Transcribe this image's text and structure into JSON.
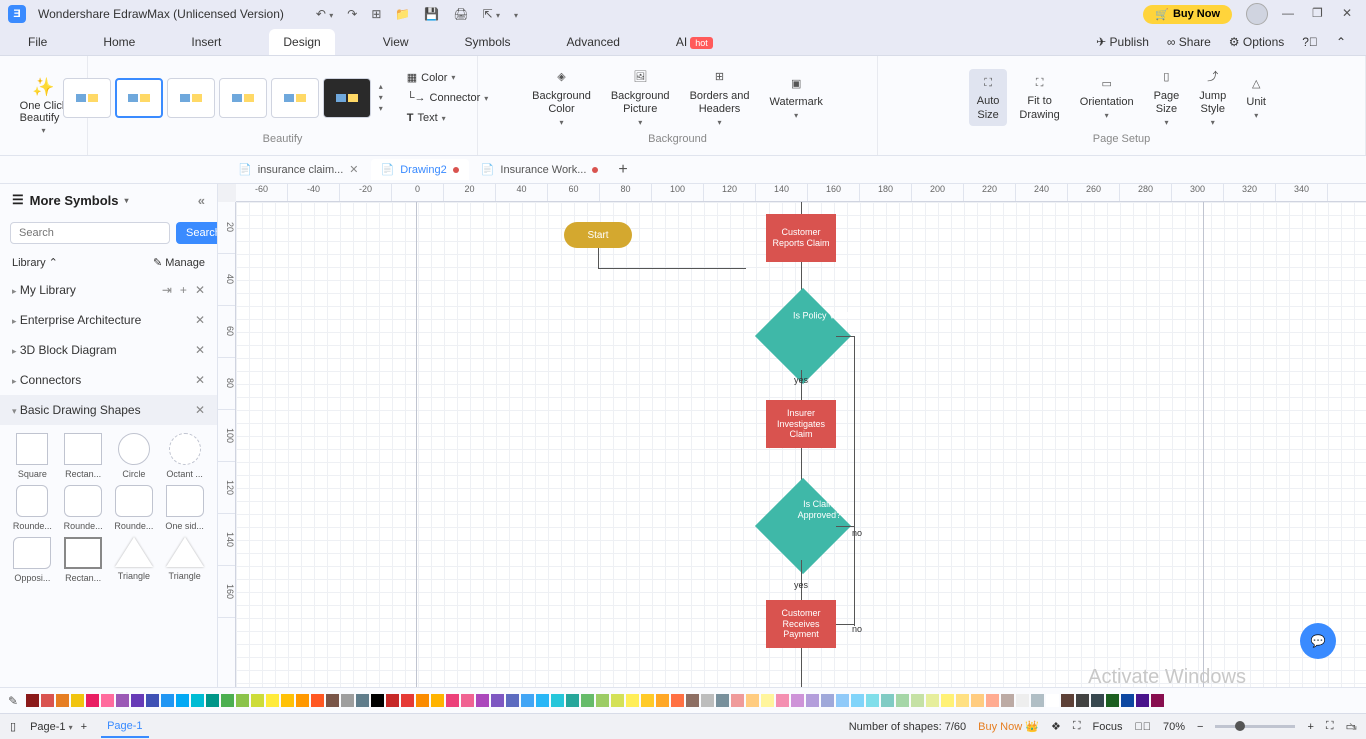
{
  "titlebar": {
    "app_name": "Wondershare EdrawMax (Unlicensed Version)",
    "buy": "Buy Now"
  },
  "menu": {
    "items": [
      "File",
      "Home",
      "Insert",
      "Design",
      "View",
      "Symbols",
      "Advanced",
      "AI"
    ],
    "active": 3,
    "ai_badge": "hot",
    "publish": "Publish",
    "share": "Share",
    "options": "Options"
  },
  "ribbon": {
    "beautify_btn": "One Click\nBeautify",
    "beautify_label": "Beautify",
    "color": "Color",
    "connector": "Connector",
    "text": "Text",
    "bg_color": "Background\nColor",
    "bg_pic": "Background\nPicture",
    "borders": "Borders and\nHeaders",
    "watermark": "Watermark",
    "bg_label": "Background",
    "auto_size": "Auto\nSize",
    "fit": "Fit to\nDrawing",
    "orient": "Orientation",
    "page_size": "Page\nSize",
    "jump": "Jump\nStyle",
    "unit": "Unit",
    "ps_label": "Page Setup"
  },
  "tabs": [
    {
      "name": "insurance claim...",
      "active": false,
      "dirty": false,
      "closable": true
    },
    {
      "name": "Drawing2",
      "active": true,
      "dirty": true,
      "closable": false
    },
    {
      "name": "Insurance Work...",
      "active": false,
      "dirty": true,
      "closable": false
    }
  ],
  "sidebar": {
    "title": "More Symbols",
    "search_ph": "Search",
    "search_btn": "Search",
    "library": "Library",
    "manage": "Manage",
    "cats": [
      "My Library",
      "Enterprise Architecture",
      "3D Block Diagram",
      "Connectors",
      "Basic Drawing Shapes"
    ],
    "shapes": [
      "Square",
      "Rectan...",
      "Circle",
      "Octant ...",
      "Rounde...",
      "Rounde...",
      "Rounde...",
      "One sid...",
      "Opposi...",
      "Rectan...",
      "Triangle",
      "Triangle"
    ]
  },
  "ruler_h": [
    "-60",
    "-40",
    "-20",
    "0",
    "20",
    "40",
    "60",
    "80",
    "100",
    "120",
    "140",
    "160",
    "180",
    "200",
    "220",
    "240",
    "260",
    "280",
    "300",
    "320",
    "340"
  ],
  "ruler_v": [
    "20",
    "40",
    "60",
    "80",
    "100",
    "120",
    "140",
    "160"
  ],
  "flowchart": {
    "start": "Start",
    "n1": "Customer Reports Claim",
    "d1": "Is Policy Valid?",
    "y1": "yes",
    "n2": "Insurer Investigates Claim",
    "d2": "Is Claim Approved?",
    "no1": "no",
    "y2": "yes",
    "n3": "Customer Receives Payment",
    "no2": "no"
  },
  "colors": [
    "#8b1a1a",
    "#d9534f",
    "#e67e22",
    "#f1c40f",
    "#e91e63",
    "#ff6b9d",
    "#9b59b6",
    "#673ab7",
    "#3f51b5",
    "#2196f3",
    "#03a9f4",
    "#00bcd4",
    "#009688",
    "#4caf50",
    "#8bc34a",
    "#cddc39",
    "#ffeb3b",
    "#ffc107",
    "#ff9800",
    "#ff5722",
    "#795548",
    "#9e9e9e",
    "#607d8b",
    "#000000",
    "#c62828",
    "#e53935",
    "#fb8c00",
    "#ffb300",
    "#ec407a",
    "#f06292",
    "#ab47bc",
    "#7e57c2",
    "#5c6bc0",
    "#42a5f5",
    "#29b6f6",
    "#26c6da",
    "#26a69a",
    "#66bb6a",
    "#9ccc65",
    "#d4e157",
    "#ffee58",
    "#ffca28",
    "#ffa726",
    "#ff7043",
    "#8d6e63",
    "#bdbdbd",
    "#78909c",
    "#ef9a9a",
    "#ffcc80",
    "#fff59d",
    "#f48fb1",
    "#ce93d8",
    "#b39ddb",
    "#9fa8da",
    "#90caf9",
    "#81d4fa",
    "#80deea",
    "#80cbc4",
    "#a5d6a7",
    "#c5e1a5",
    "#e6ee9c",
    "#fff176",
    "#ffe082",
    "#ffcc80",
    "#ffab91",
    "#bcaaa4",
    "#eeeeee",
    "#b0bec5",
    "#ffffff",
    "#5d4037",
    "#424242",
    "#37474f",
    "#1b5e20",
    "#0d47a1",
    "#4a148c",
    "#880e4f"
  ],
  "status": {
    "page_sel": "Page-1",
    "page_tab": "Page-1",
    "shapes": "Number of shapes: 7/60",
    "buy": "Buy Now",
    "focus": "Focus",
    "zoom": "70%"
  },
  "watermark": "Activate Windows"
}
